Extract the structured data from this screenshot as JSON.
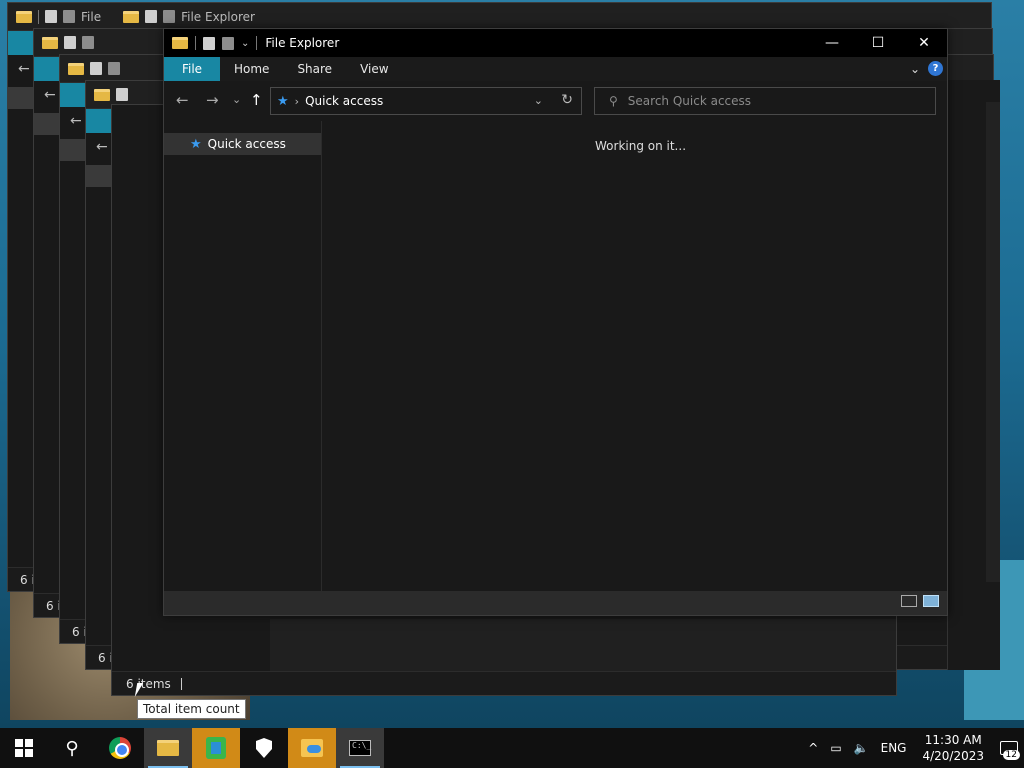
{
  "window": {
    "title": "File Explorer",
    "title_short": "File",
    "minimize_glyph": "—",
    "maximize_glyph": "☐",
    "close_glyph": "✕"
  },
  "ribbon": {
    "tabs": [
      "File",
      "Home",
      "Share",
      "View"
    ],
    "help_glyph": "?",
    "collapse_glyph": "⌄"
  },
  "nav": {
    "back_glyph": "←",
    "forward_glyph": "→",
    "recent_glyph": "⌄",
    "up_glyph": "↑"
  },
  "address": {
    "path_label": "Quick access",
    "separator": "›",
    "refresh_glyph": "↻"
  },
  "search": {
    "placeholder": "Search Quick access"
  },
  "sidebar": {
    "items": [
      {
        "label": "Quick access"
      }
    ]
  },
  "content": {
    "status_message": "Working on it..."
  },
  "background_window": {
    "status_text": "6 items",
    "status_fragment": "6 i"
  },
  "tooltip": {
    "text": "Total item count"
  },
  "taskbar": {
    "apps": [
      "start",
      "search",
      "chrome",
      "file-explorer",
      "settings-app",
      "security",
      "onedrive-folder",
      "command-prompt"
    ],
    "search_glyph": "⚲"
  },
  "tray": {
    "language": "ENG",
    "time": "11:30 AM",
    "date": "4/20/2023",
    "notification_count": "12",
    "chevron_glyph": "^"
  },
  "colors": {
    "accent": "#1887a3",
    "window_bg": "#191919",
    "titlebar_bg": "#000000"
  }
}
